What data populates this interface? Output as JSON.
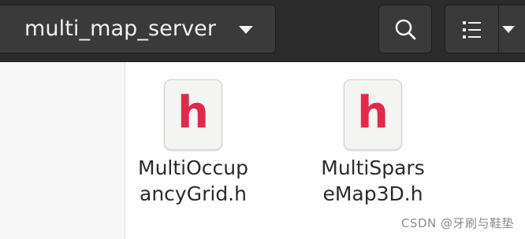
{
  "header": {
    "path_label": "multi_map_server"
  },
  "files": [
    {
      "name": "MultiOccup\nancyGrid.h",
      "icon_letter": "h"
    },
    {
      "name": "MultiSpars\neMap3D.h",
      "icon_letter": "h"
    }
  ],
  "watermark": "CSDN @牙刷与鞋垫",
  "icons": {
    "search": "search-icon",
    "view_list": "list-view-icon",
    "dropdown": "chevron-down-icon",
    "file": "c-header-file-icon"
  },
  "colors": {
    "header_bg": "#2b2b2b",
    "button_bg": "#3a3a3a",
    "header_glyph": "#e02a4a"
  }
}
